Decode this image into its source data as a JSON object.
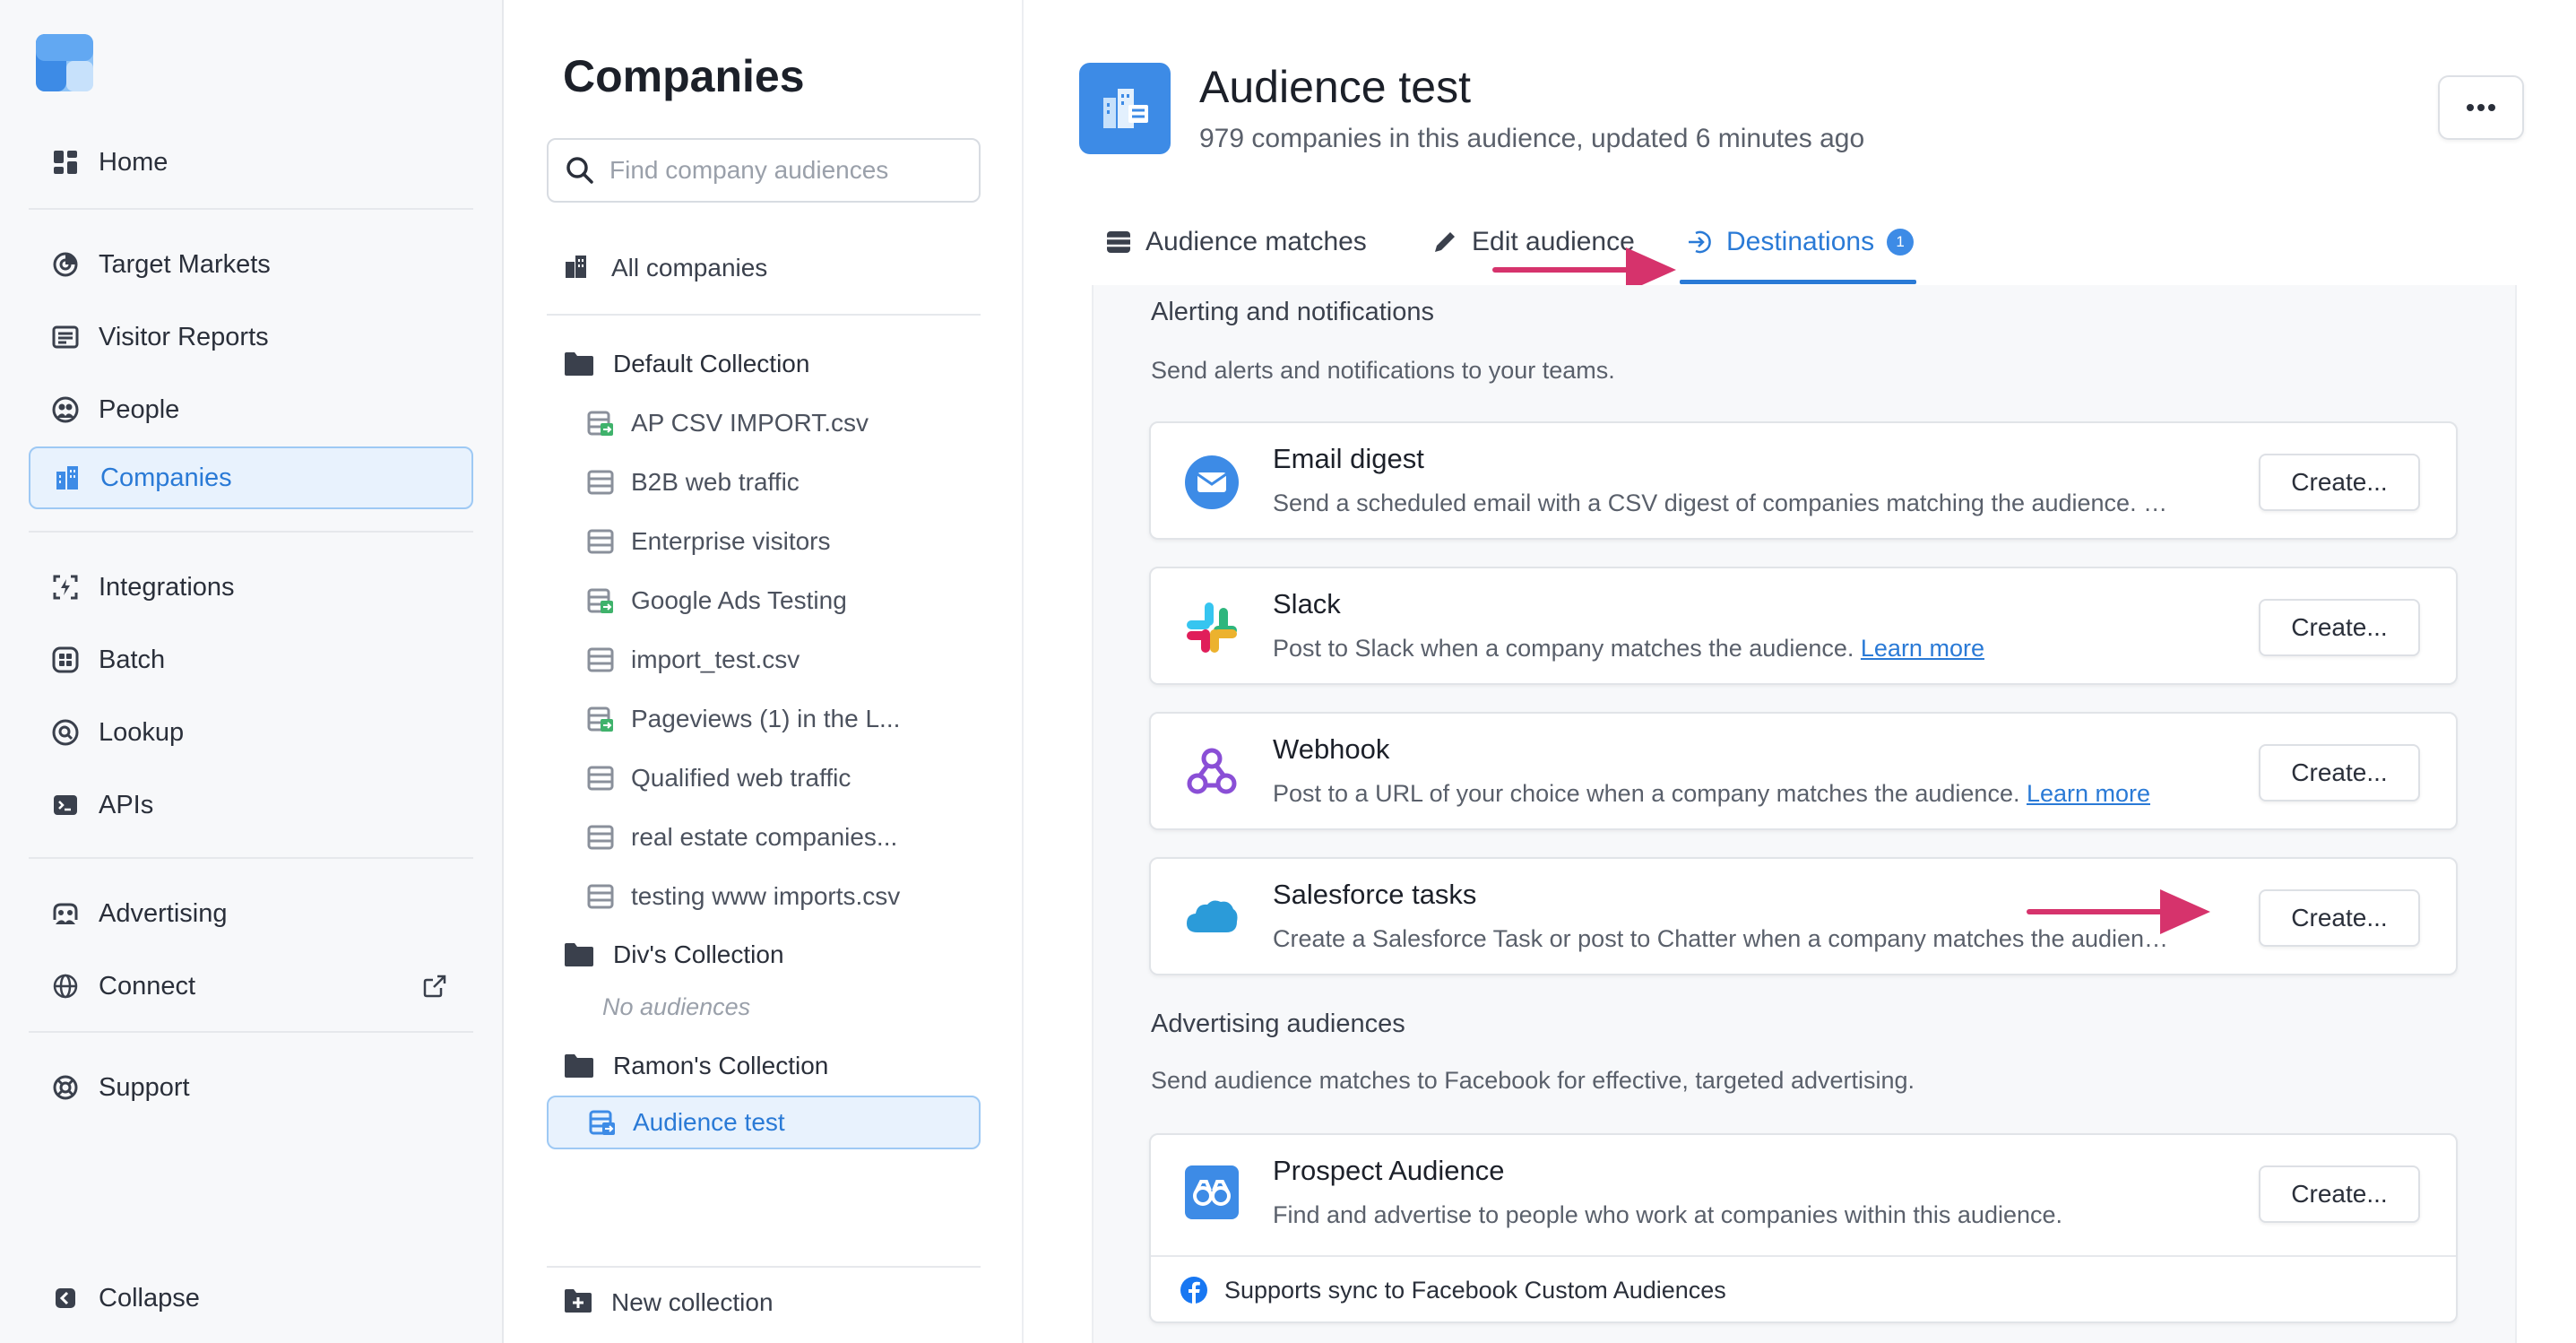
{
  "nav": {
    "items": [
      {
        "label": "Home",
        "icon": "dashboard-icon"
      },
      {
        "label": "Target Markets",
        "icon": "target-icon"
      },
      {
        "label": "Visitor Reports",
        "icon": "report-icon"
      },
      {
        "label": "People",
        "icon": "people-icon"
      },
      {
        "label": "Companies",
        "icon": "building-icon",
        "active": true
      },
      {
        "label": "Integrations",
        "icon": "integrations-icon"
      },
      {
        "label": "Batch",
        "icon": "batch-icon"
      },
      {
        "label": "Lookup",
        "icon": "lookup-icon"
      },
      {
        "label": "APIs",
        "icon": "terminal-icon"
      },
      {
        "label": "Advertising",
        "icon": "advertising-icon"
      },
      {
        "label": "Connect",
        "icon": "globe-icon"
      },
      {
        "label": "Support",
        "icon": "support-icon"
      }
    ],
    "collapse_label": "Collapse"
  },
  "companies_panel": {
    "title": "Companies",
    "search_placeholder": "Find company audiences",
    "all_companies": "All companies",
    "collections": [
      {
        "name": "Default Collection",
        "audiences": [
          "AP CSV IMPORT.csv",
          "B2B web traffic",
          "Enterprise visitors",
          "Google Ads Testing",
          "import_test.csv",
          "Pageviews (1) in the L...",
          "Qualified web traffic",
          "real estate companies...",
          "testing www imports.csv"
        ]
      },
      {
        "name": "Div's Collection",
        "empty_label": "No audiences"
      },
      {
        "name": "Ramon's Collection",
        "audiences": [
          "Audience test"
        ]
      }
    ],
    "new_collection": "New collection"
  },
  "header": {
    "title": "Audience test",
    "subtitle": "979 companies in this audience, updated 6 minutes ago",
    "more_label": "•••"
  },
  "tabs": [
    {
      "label": "Audience matches"
    },
    {
      "label": "Edit audience"
    },
    {
      "label": "Destinations",
      "badge": "1",
      "active": true
    }
  ],
  "alerting": {
    "title": "Alerting and notifications",
    "description": "Send alerts and notifications to your teams.",
    "cards": [
      {
        "title": "Email digest",
        "description": "Send a scheduled email with a CSV digest of companies matching the audience. …",
        "button": "Create..."
      },
      {
        "title": "Slack",
        "description": "Post to Slack when a company matches the audience.",
        "link": "Learn more",
        "button": "Create..."
      },
      {
        "title": "Webhook",
        "description": "Post to a URL of your choice when a company matches the audience.",
        "link": "Learn more",
        "button": "Create..."
      },
      {
        "title": "Salesforce tasks",
        "description": "Create a Salesforce Task or post to Chatter when a company matches the audien…",
        "button": "Create..."
      }
    ]
  },
  "advertising": {
    "title": "Advertising audiences",
    "description": "Send audience matches to Facebook for effective, targeted advertising.",
    "cards": [
      {
        "title": "Prospect Audience",
        "description": "Find and advertise to people who work at companies within this audience.",
        "button": "Create...",
        "footer": "Supports sync to Facebook Custom Audiences"
      }
    ]
  },
  "colors": {
    "accent": "#2a7ad6",
    "arrow": "#d6336c",
    "active_bg": "#e8f2fd"
  }
}
